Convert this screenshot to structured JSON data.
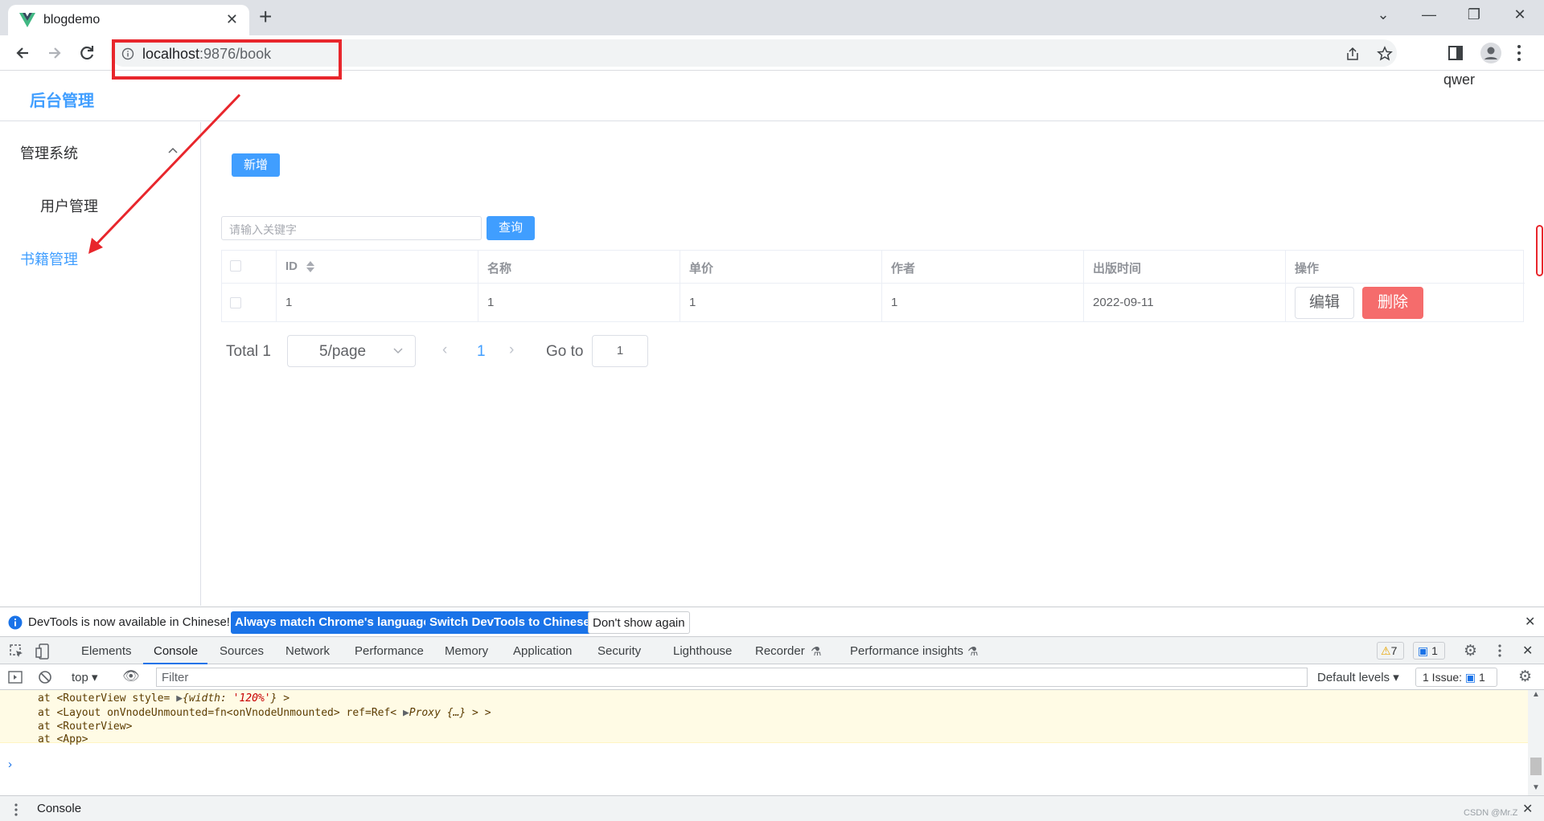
{
  "browser": {
    "tab_title": "blogdemo",
    "url_host": "localhost",
    "url_rest": ":9876/book"
  },
  "app": {
    "title": "后台管理",
    "user": "qwer"
  },
  "sidebar": {
    "group": "管理系统",
    "items": [
      {
        "label": "用户管理"
      },
      {
        "label": "书籍管理"
      }
    ]
  },
  "main": {
    "add_button": "新增",
    "search_placeholder": "请输入关键字",
    "search_button": "查询",
    "table": {
      "headers": [
        "ID",
        "名称",
        "单价",
        "作者",
        "出版时间",
        "操作"
      ],
      "rows": [
        {
          "id": "1",
          "name": "1",
          "price": "1",
          "author": "1",
          "date": "2022-09-11"
        }
      ],
      "edit_label": "编辑",
      "delete_label": "删除"
    },
    "pagination": {
      "total": "Total 1",
      "page_size": "5/page",
      "current_page": "1",
      "goto_label": "Go to",
      "goto_value": "1"
    }
  },
  "devtools": {
    "infobar_message": "DevTools is now available in Chinese!",
    "infobar_buttons": [
      "Always match Chrome's language",
      "Switch DevTools to Chinese",
      "Don't show again"
    ],
    "tabs": [
      "Elements",
      "Console",
      "Sources",
      "Network",
      "Performance",
      "Memory",
      "Application",
      "Security",
      "Lighthouse",
      "Recorder",
      "Performance insights"
    ],
    "warning_count": "7",
    "message_count": "1",
    "context": "top",
    "filter_placeholder": "Filter",
    "levels": "Default levels",
    "issues_label": "1 Issue:",
    "issues_count": "1",
    "console_lines": {
      "l1_pre": "at <RouterView style= ",
      "l1_obj": "{width: ",
      "l1_str": "'120%'",
      "l1_post": "} >",
      "l2_pre": "at <Layout onVnodeUnmounted=fn<onVnodeUnmounted> ref=Ref< ",
      "l2_obj": "Proxy {…}",
      "l2_post": " > >",
      "l3": "at <RouterView>",
      "l4": "at <App>"
    },
    "drawer_tab": "Console",
    "watermark": "CSDN @Mr.Z"
  },
  "colors": {
    "primary": "#409eff",
    "danger": "#f56c6c",
    "annotation": "#e8262c",
    "devtools_blue": "#1a73e8"
  }
}
